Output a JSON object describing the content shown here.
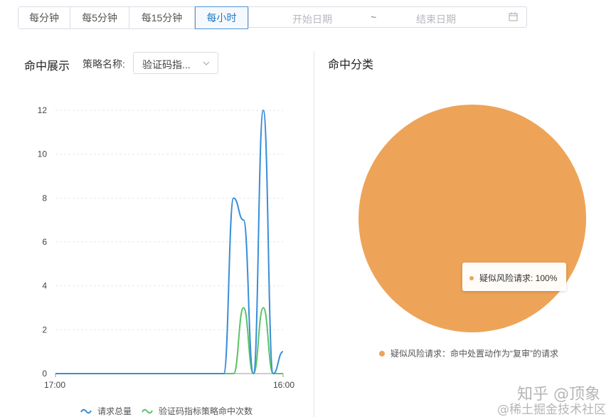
{
  "toolbar": {
    "intervals": [
      "每分钟",
      "每5分钟",
      "每15分钟",
      "每小时"
    ],
    "active": "每小时",
    "start_placeholder": "开始日期",
    "separator": "~",
    "end_placeholder": "结束日期"
  },
  "left_panel": {
    "title": "命中展示",
    "filter_label": "策略名称:",
    "filter_value": "验证码指..."
  },
  "right_panel": {
    "title": "命中分类",
    "tooltip": "疑似风险请求: 100%",
    "legend": "疑似风险请求：命中处置动作为“复审”的请求"
  },
  "watermark": {
    "line1": "知乎 @顶象",
    "line2": "@稀土掘金技术社区"
  },
  "colors": {
    "accent": "#1f78c7",
    "series_total": "#3a8ed8",
    "series_hits": "#5cc36a",
    "pie": "#eda458"
  },
  "chart_data": [
    {
      "type": "line",
      "x_ticks": [
        "17:00",
        "16:00"
      ],
      "y_ticks": [
        0,
        2,
        4,
        6,
        8,
        10,
        12
      ],
      "ylim": [
        0,
        12
      ],
      "x": [
        0,
        1,
        2,
        3,
        4,
        5,
        6,
        7,
        8,
        9,
        10,
        11,
        12,
        13,
        14,
        15,
        16,
        17,
        18,
        19,
        20,
        21,
        22,
        23
      ],
      "series": [
        {
          "name": "请求总量",
          "values": [
            0,
            0,
            0,
            0,
            0,
            0,
            0,
            0,
            0,
            0,
            0,
            0,
            0,
            0,
            0,
            0,
            0,
            0,
            8,
            7,
            0,
            12,
            0,
            1
          ]
        },
        {
          "name": "验证码指标策略命中次数",
          "values": [
            0,
            0,
            0,
            0,
            0,
            0,
            0,
            0,
            0,
            0,
            0,
            0,
            0,
            0,
            0,
            0,
            0,
            0,
            0,
            3,
            0,
            3,
            0,
            0
          ]
        }
      ],
      "grid": true,
      "legend_position": "bottom"
    },
    {
      "type": "pie",
      "categories": [
        "疑似风险请求"
      ],
      "values": [
        100
      ],
      "legend_position": "bottom"
    }
  ]
}
